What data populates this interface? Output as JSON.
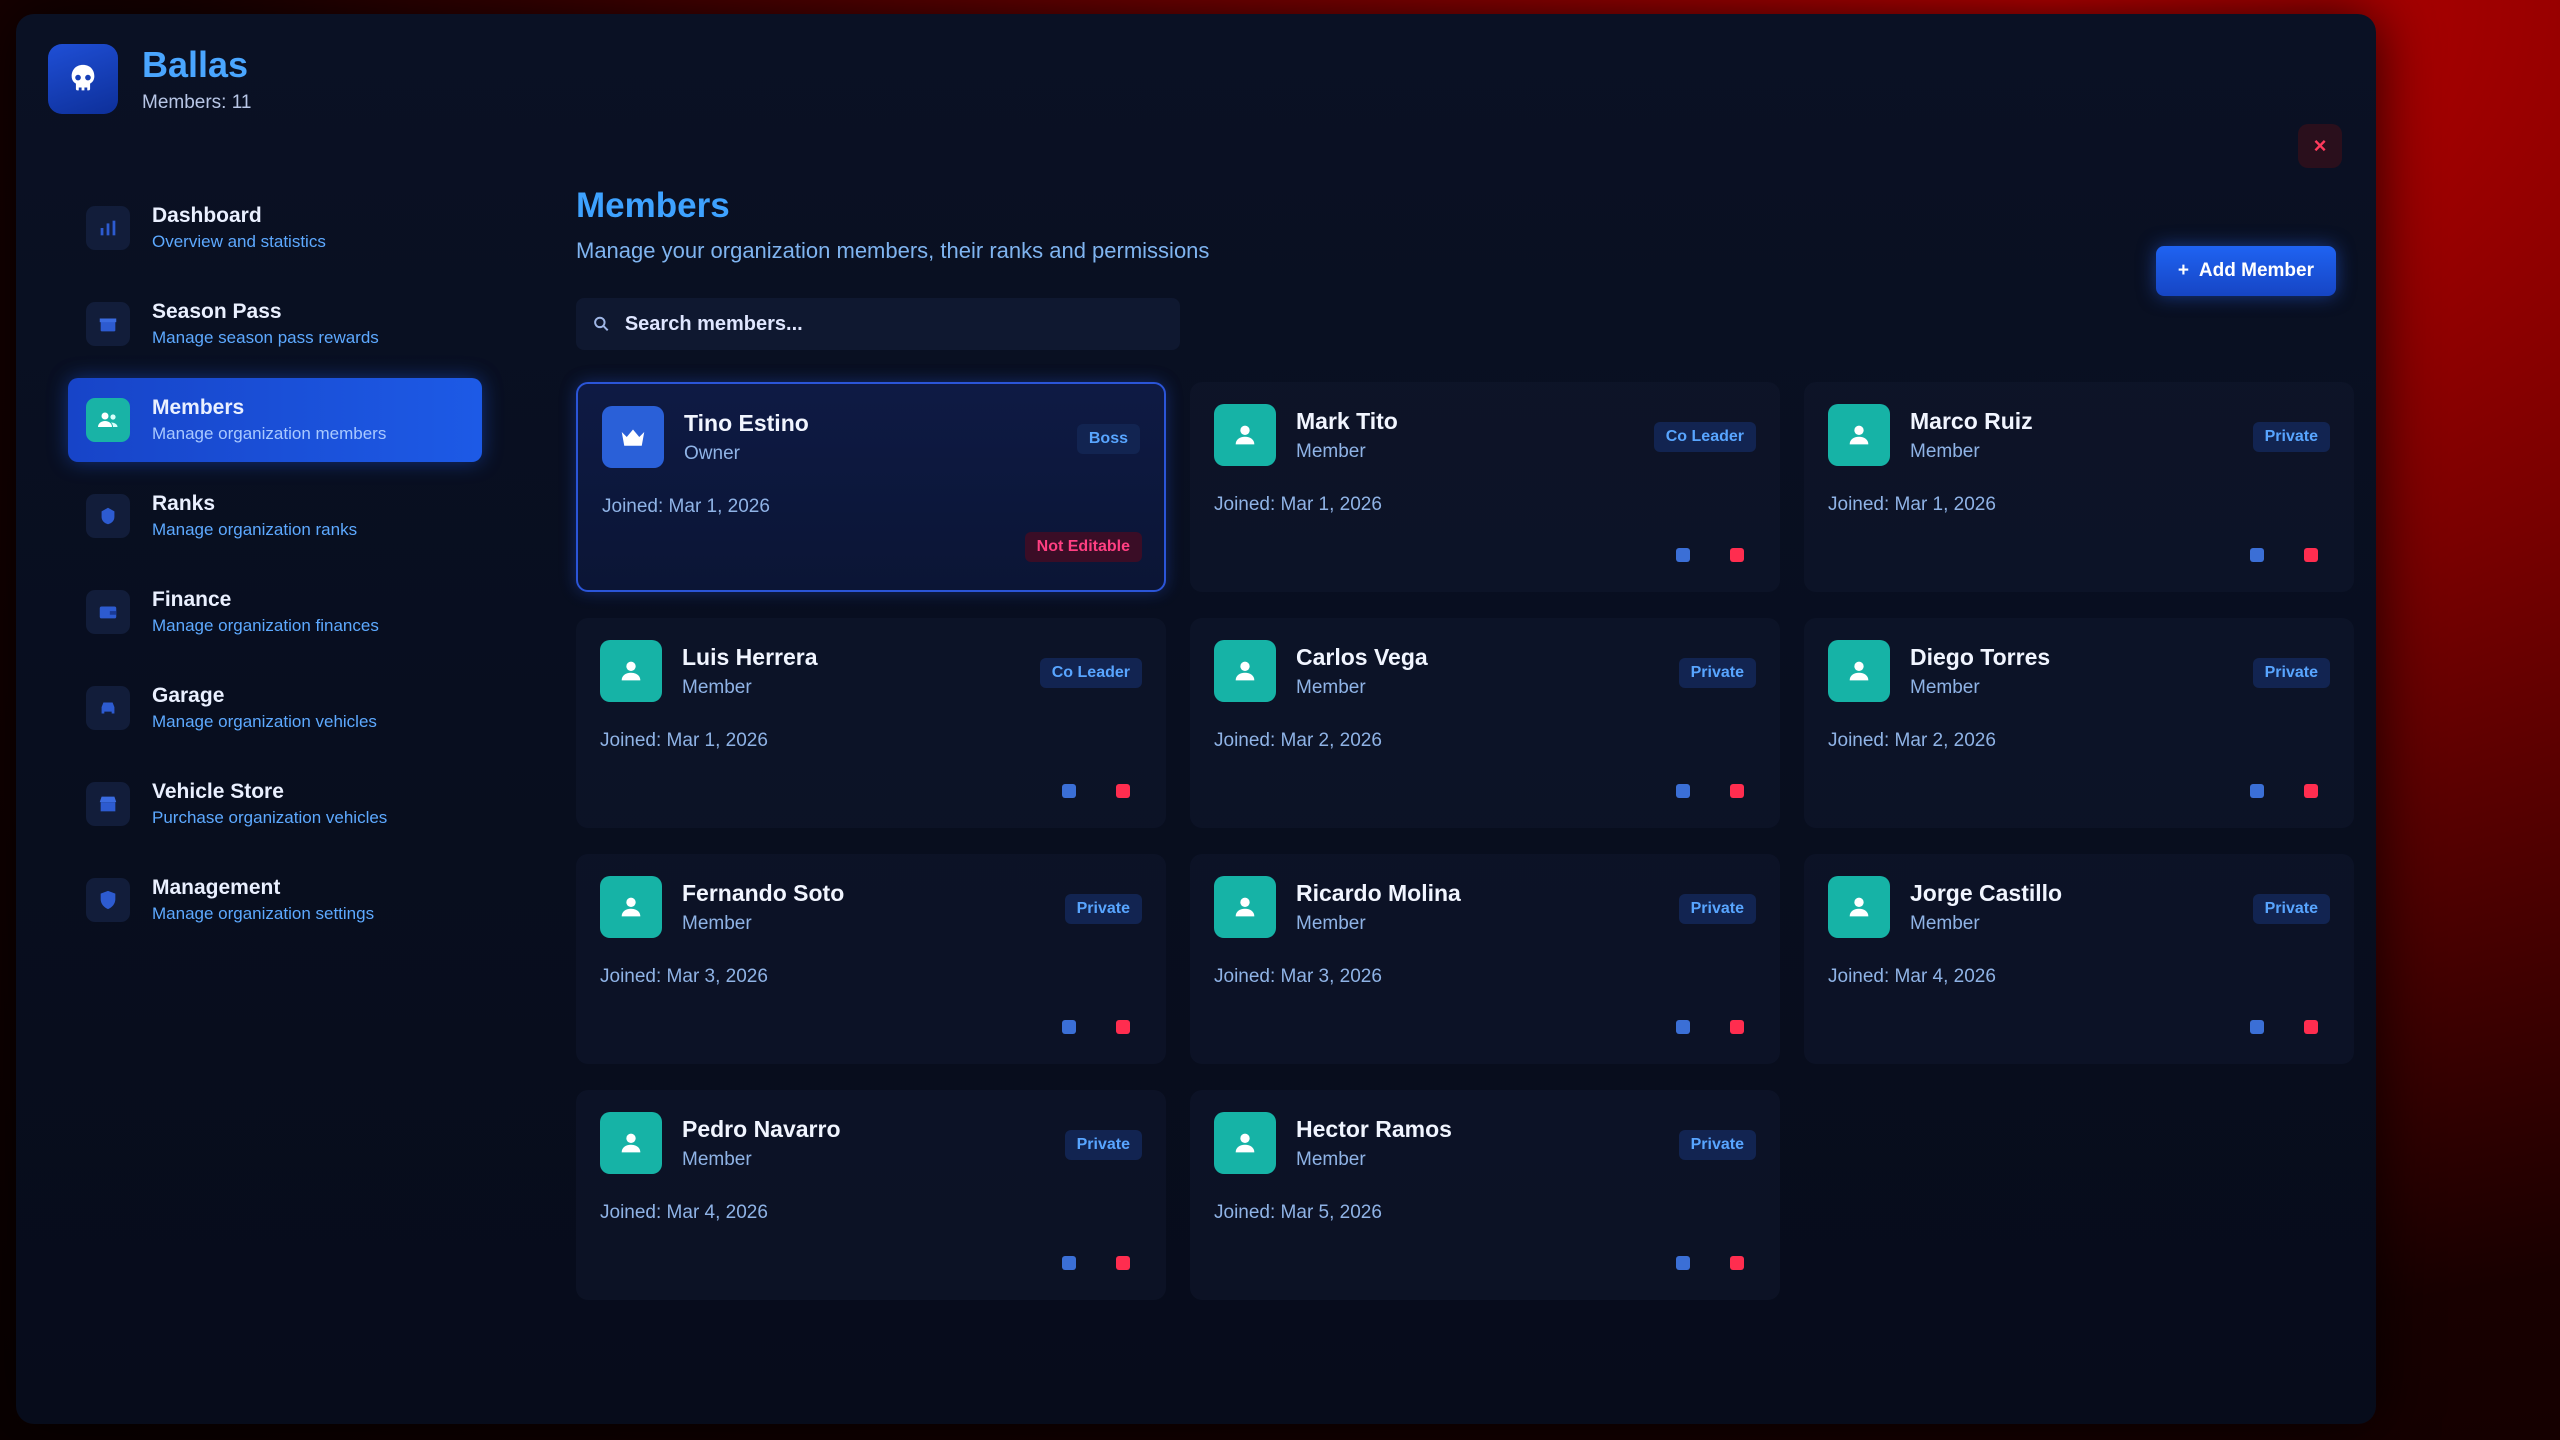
{
  "brand": {
    "title": "Ballas",
    "subtitle": "Members: 11",
    "logo_icon": "skull-icon"
  },
  "close_label": "×",
  "sidebar": {
    "items": [
      {
        "label": "Dashboard",
        "sub": "Overview and statistics",
        "icon": "chart-icon"
      },
      {
        "label": "Season Pass",
        "sub": "Manage season pass rewards",
        "icon": "gift-icon"
      },
      {
        "label": "Members",
        "sub": "Manage organization members",
        "icon": "users-icon",
        "active": true
      },
      {
        "label": "Ranks",
        "sub": "Manage organization ranks",
        "icon": "badge-icon"
      },
      {
        "label": "Finance",
        "sub": "Manage organization finances",
        "icon": "wallet-icon"
      },
      {
        "label": "Garage",
        "sub": "Manage organization vehicles",
        "icon": "car-icon"
      },
      {
        "label": "Vehicle Store",
        "sub": "Purchase organization vehicles",
        "icon": "store-icon"
      },
      {
        "label": "Management",
        "sub": "Manage organization settings",
        "icon": "shield-icon"
      }
    ]
  },
  "main": {
    "title": "Members",
    "subtitle": "Manage your organization members, their ranks and permissions",
    "add_button": "Add Member",
    "search_placeholder": "Search members..."
  },
  "members": [
    {
      "name": "Tino Estino",
      "role": "Owner",
      "rank": "Boss",
      "joined": "Joined: Mar 1, 2026",
      "owner": true,
      "locked_label": "Not Editable"
    },
    {
      "name": "Mark Tito",
      "role": "Member",
      "rank": "Co Leader",
      "joined": "Joined: Mar 1, 2026"
    },
    {
      "name": "Marco Ruiz",
      "role": "Member",
      "rank": "Private",
      "joined": "Joined: Mar 1, 2026"
    },
    {
      "name": "Luis Herrera",
      "role": "Member",
      "rank": "Co Leader",
      "joined": "Joined: Mar 1, 2026"
    },
    {
      "name": "Carlos Vega",
      "role": "Member",
      "rank": "Private",
      "joined": "Joined: Mar 2, 2026"
    },
    {
      "name": "Diego Torres",
      "role": "Member",
      "rank": "Private",
      "joined": "Joined: Mar 2, 2026"
    },
    {
      "name": "Fernando Soto",
      "role": "Member",
      "rank": "Private",
      "joined": "Joined: Mar 3, 2026"
    },
    {
      "name": "Ricardo Molina",
      "role": "Member",
      "rank": "Private",
      "joined": "Joined: Mar 3, 2026"
    },
    {
      "name": "Jorge Castillo",
      "role": "Member",
      "rank": "Private",
      "joined": "Joined: Mar 4, 2026"
    },
    {
      "name": "Pedro Navarro",
      "role": "Member",
      "rank": "Private",
      "joined": "Joined: Mar 4, 2026"
    },
    {
      "name": "Hector Ramos",
      "role": "Member",
      "rank": "Private",
      "joined": "Joined: Mar 5, 2026"
    }
  ],
  "colors": {
    "accent": "#1f63f2",
    "teal": "#16b3a6",
    "danger": "#ff2d4f",
    "title_blue": "#3ea2ff"
  }
}
